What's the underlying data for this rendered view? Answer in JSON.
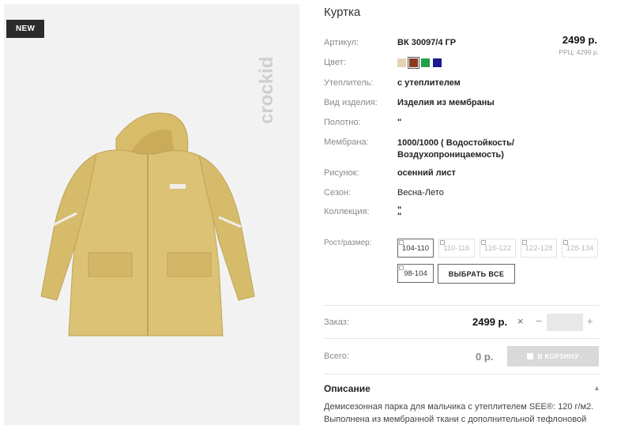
{
  "image": {
    "badge": "NEW",
    "brand": "crockid"
  },
  "product": {
    "title": "Куртка",
    "rows": [
      {
        "label": "Артикул:",
        "value": "ВК 30097/4 ГР"
      },
      {
        "label": "Цвет:",
        "value": ""
      },
      {
        "label": "Утеплитель:",
        "value": "с утеплителем"
      },
      {
        "label": "Вид изделия:",
        "value": "Изделия из мембраны"
      },
      {
        "label": "Полотно:",
        "value": "\""
      },
      {
        "label": "Мембрана:",
        "value": "1000/1000 ( Водостойкость/ Воздухопроницаемость)"
      },
      {
        "label": "Рисунок:",
        "value": "осенний лист"
      },
      {
        "label": "Сезон:",
        "value": "Весна-Лето"
      },
      {
        "label": "Коллекция:",
        "value": "\" \""
      }
    ],
    "price": "2499 р.",
    "rrp": "РРЦ: 4299 р.",
    "colors": [
      "#e3d3b3",
      "#8a3b1e",
      "#23a04a",
      "#1a1a8c"
    ],
    "selected_color_index": 1
  },
  "sizes": {
    "label": "Рост/размер:",
    "options": [
      {
        "label": "104-110",
        "active": true
      },
      {
        "label": "110-116",
        "active": false
      },
      {
        "label": "116-122",
        "active": false
      },
      {
        "label": "122-128",
        "active": false
      },
      {
        "label": "128-134",
        "active": false
      },
      {
        "label": "98-104",
        "active": true
      }
    ],
    "select_all": "ВЫБРАТЬ ВСЕ"
  },
  "order": {
    "label": "Заказ:",
    "price": "2499 р.",
    "remove": "×",
    "minus": "−",
    "plus": "+",
    "quantity": ""
  },
  "total": {
    "label": "Всего:",
    "value": "0 р.",
    "cart_button": "В КОРЗИНУ"
  },
  "description": {
    "title": "Описание",
    "text": "Демисезонная парка для мальчика с утеплителем SEE®: 120 г/м2. Выполнена из мембранной ткани с дополнительной тефлоновой"
  }
}
